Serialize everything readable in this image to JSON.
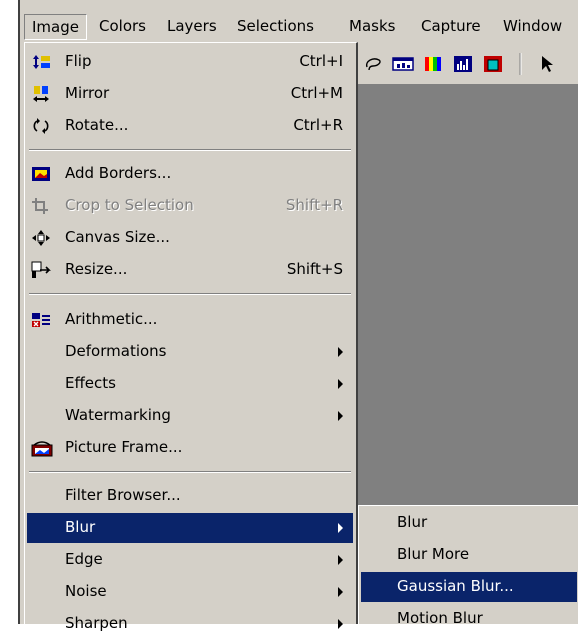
{
  "menubar": {
    "items": [
      {
        "label": "Image",
        "active": true
      },
      {
        "label": "Colors"
      },
      {
        "label": "Layers"
      },
      {
        "label": "Selections"
      },
      {
        "label": "Masks"
      },
      {
        "label": "Capture"
      },
      {
        "label": "Window"
      }
    ]
  },
  "image_menu": {
    "items": [
      {
        "label": "Flip",
        "shortcut": "Ctrl+I",
        "icon": "flip-icon"
      },
      {
        "label": "Mirror",
        "shortcut": "Ctrl+M",
        "icon": "mirror-icon"
      },
      {
        "label": "Rotate...",
        "shortcut": "Ctrl+R",
        "icon": "rotate-icon"
      },
      {
        "label": "Add Borders...",
        "icon": "add-borders-icon"
      },
      {
        "label": "Crop to Selection",
        "shortcut": "Shift+R",
        "icon": "crop-icon",
        "disabled": true
      },
      {
        "label": "Canvas Size...",
        "icon": "canvas-size-icon"
      },
      {
        "label": "Resize...",
        "shortcut": "Shift+S",
        "icon": "resize-icon"
      },
      {
        "label": "Arithmetic...",
        "icon": "arithmetic-icon"
      },
      {
        "label": "Deformations",
        "submenu": true
      },
      {
        "label": "Effects",
        "submenu": true
      },
      {
        "label": "Watermarking",
        "submenu": true
      },
      {
        "label": "Picture Frame...",
        "icon": "picture-frame-icon"
      },
      {
        "label": "Filter Browser..."
      },
      {
        "label": "Blur",
        "submenu": true,
        "highlighted": true
      },
      {
        "label": "Edge",
        "submenu": true
      },
      {
        "label": "Noise",
        "submenu": true
      },
      {
        "label": "Sharpen",
        "submenu": true
      }
    ]
  },
  "blur_submenu": {
    "items": [
      {
        "label": "Blur"
      },
      {
        "label": "Blur More"
      },
      {
        "label": "Gaussian Blur...",
        "highlighted": true
      },
      {
        "label": "Motion Blur"
      }
    ]
  },
  "toolbar": {
    "icons": [
      "lasso-icon",
      "histogram-window-icon",
      "color-palette-icon",
      "histogram-icon",
      "overview-icon",
      "arrow-pointer-icon"
    ]
  },
  "colors": {
    "highlight": "#0a246a",
    "menu_bg": "#d4d0c8",
    "workspace": "#808080"
  }
}
